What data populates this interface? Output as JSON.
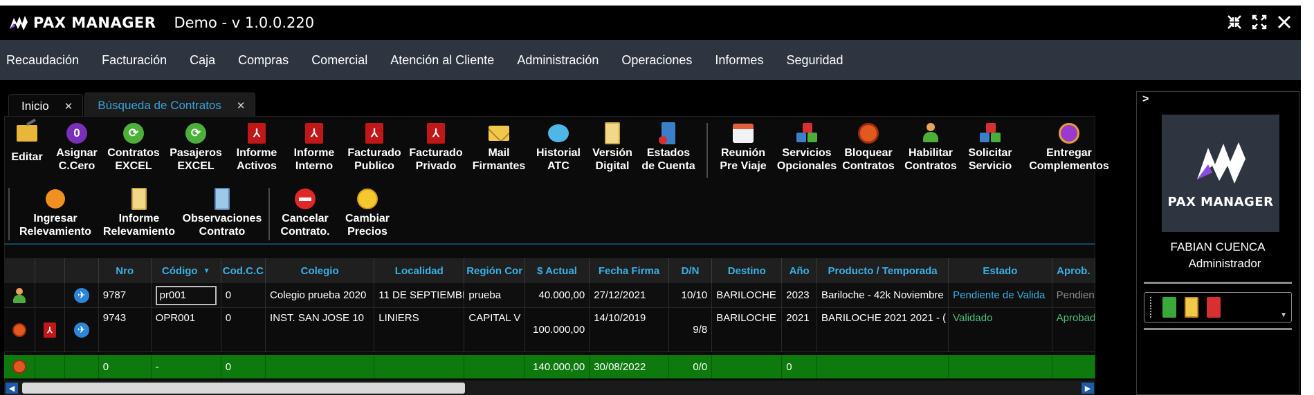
{
  "app": {
    "brand": "PAX MANAGER",
    "title": "Demo - v 1.0.0.220"
  },
  "window_controls": [
    "collapse-icon",
    "expand-icon",
    "close-icon"
  ],
  "menu": [
    "Recaudación",
    "Facturación",
    "Caja",
    "Compras",
    "Comercial",
    "Atención al Cliente",
    "Administración",
    "Operaciones",
    "Informes",
    "Seguridad"
  ],
  "tabs": [
    {
      "label": "Inicio",
      "active": false
    },
    {
      "label": "Búsqueda de Contratos",
      "active": true
    }
  ],
  "toolbar": {
    "row1": [
      {
        "label": "Editar",
        "icon": "folder-edit-icon"
      },
      {
        "label": "Asignar\nC.Cero",
        "icon": "zero-badge-icon"
      },
      {
        "label": "Contratos\nEXCEL",
        "icon": "excel-refresh-icon"
      },
      {
        "label": "Pasajeros\nEXCEL",
        "icon": "excel-refresh-icon"
      },
      {
        "label": "Informe\nActivos",
        "icon": "pdf-icon"
      },
      {
        "label": "Informe\nInterno",
        "icon": "pdf-icon"
      },
      {
        "label": "Facturado\nPublico",
        "icon": "pdf-icon"
      },
      {
        "label": "Facturado\nPrivado",
        "icon": "pdf-icon"
      },
      {
        "label": "Mail\nFirmantes",
        "icon": "mail-icon"
      },
      {
        "label": "Historial\nATC",
        "icon": "chat-icon"
      },
      {
        "label": "Versión\nDigital",
        "icon": "book-icon"
      },
      {
        "label": "Estados\nde Cuenta",
        "icon": "door-icon"
      },
      {
        "label": "Reunión\nPre Viaje",
        "icon": "calendar-icon"
      },
      {
        "label": "Servicios\nOpcionales",
        "icon": "cubes-icon"
      },
      {
        "label": "Bloquear\nContratos",
        "icon": "block-icon"
      },
      {
        "label": "Habilitar\nContratos",
        "icon": "user-enable-icon"
      },
      {
        "label": "Solicitar\nServicio",
        "icon": "cubes-icon"
      },
      {
        "label": "Entregar\nComplementos",
        "icon": "gift-icon"
      }
    ],
    "row2": [
      {
        "label": "Ingresar\nRelevamiento",
        "icon": "rss-icon"
      },
      {
        "label": "Informe\nRelevamiento",
        "icon": "book-icon"
      },
      {
        "label": "Observaciones\nContrato",
        "icon": "book-icon"
      },
      {
        "label": "Cancelar\nContrato.",
        "icon": "stop-icon"
      },
      {
        "label": "Cambiar\nPrecios",
        "icon": "coin-icon"
      }
    ]
  },
  "grid": {
    "columns": [
      "",
      "",
      "",
      "Nro",
      "Código",
      "Cod.C.C",
      "Colegio",
      "Localidad",
      "Región Cor",
      "$ Actual",
      "Fecha Firma",
      "D/N",
      "Destino",
      "Año",
      "Producto / Temporada",
      "Estado",
      "Aprob."
    ],
    "rows": [
      {
        "icons": [
          "user-enable-icon",
          "",
          "plane-icon"
        ],
        "nro": "9787",
        "codigo": "pr001",
        "codcc": "0",
        "colegio": "Colegio prueba 2020",
        "localidad": "11 DE SEPTIEMBI",
        "region": "prueba",
        "actual": "40.000,00",
        "fecha": "27/12/2021",
        "dn": "10/10",
        "destino": "BARILOCHE",
        "anio": "2023",
        "producto": "Bariloche - 42k Noviembre",
        "estado": "Pendiente de Valida",
        "aprob": "Pendient"
      },
      {
        "icons": [
          "block-icon",
          "pdf-icon",
          "plane-icon"
        ],
        "nro": "9743",
        "codigo": "OPR001",
        "codcc": "0",
        "colegio": "INST. SAN JOSE 10",
        "localidad": "LINIERS",
        "region": "CAPITAL V",
        "actual": "100.000,00",
        "fecha": "14/10/2019",
        "dn": "9/8",
        "destino": "BARILOCHE",
        "anio": "2021",
        "producto": "BARILOCHE 2021 2021 - (",
        "estado": "Validado",
        "aprob": "Aprobad"
      }
    ],
    "total": {
      "icon": "block-icon",
      "nro": "0",
      "codigo": "-",
      "codcc": "0",
      "actual": "140.000,00",
      "fecha": "30/08/2022",
      "dn": "0/0",
      "anio": "0"
    }
  },
  "side": {
    "toggle": ">",
    "logo_text": "PAX MANAGER",
    "user_name": "FABIAN CUENCA",
    "user_role": "Administrador"
  },
  "colors": {
    "menubar": "#2f3441",
    "accent": "#3ab0e6",
    "total_row": "#0e7a0e"
  }
}
